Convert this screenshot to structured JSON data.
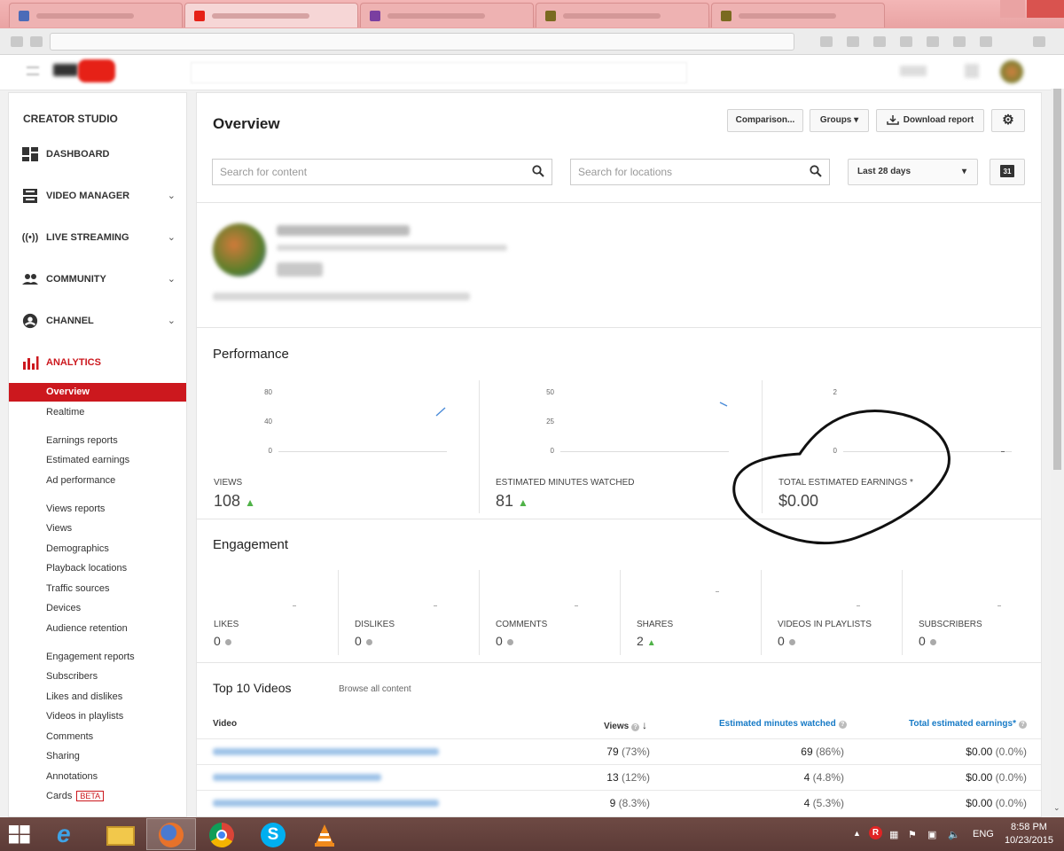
{
  "studio": {
    "title": "CREATOR STUDIO",
    "main_items": [
      {
        "label": "DASHBOARD",
        "icon": "dashboard-icon"
      },
      {
        "label": "VIDEO MANAGER",
        "icon": "video-manager-icon"
      },
      {
        "label": "LIVE STREAMING",
        "icon": "live-streaming-icon"
      },
      {
        "label": "COMMUNITY",
        "icon": "community-icon"
      },
      {
        "label": "CHANNEL",
        "icon": "channel-icon"
      },
      {
        "label": "ANALYTICS",
        "icon": "analytics-icon"
      }
    ],
    "analytics_items": [
      "Overview",
      "Realtime",
      "Earnings reports",
      "Estimated earnings",
      "Ad performance",
      "Views reports",
      "Views",
      "Demographics",
      "Playback locations",
      "Traffic sources",
      "Devices",
      "Audience retention",
      "Engagement reports",
      "Subscribers",
      "Likes and dislikes",
      "Videos in playlists",
      "Comments",
      "Sharing",
      "Annotations",
      "Cards"
    ],
    "beta_label": "BETA",
    "accent": "#cc181e"
  },
  "header": {
    "title": "Overview",
    "comparison": "Comparison...",
    "groups": "Groups",
    "download": "Download report",
    "search_content": "Search for content",
    "search_locations": "Search for locations",
    "date_range": "Last 28 days",
    "calendar_day": "31"
  },
  "performance": {
    "title": "Performance",
    "metrics": [
      {
        "label": "VIEWS",
        "value": "108",
        "ticks": [
          "80",
          "40",
          "0"
        ]
      },
      {
        "label": "ESTIMATED MINUTES WATCHED",
        "value": "81",
        "ticks": [
          "50",
          "25",
          "0"
        ]
      },
      {
        "label": "TOTAL ESTIMATED EARNINGS *",
        "value": "$0.00",
        "ticks": [
          "2",
          "0"
        ]
      }
    ]
  },
  "engagement": {
    "title": "Engagement",
    "metrics": [
      {
        "label": "LIKES",
        "value": "0"
      },
      {
        "label": "DISLIKES",
        "value": "0"
      },
      {
        "label": "COMMENTS",
        "value": "0"
      },
      {
        "label": "SHARES",
        "value": "2"
      },
      {
        "label": "VIDEOS IN PLAYLISTS",
        "value": "0"
      },
      {
        "label": "SUBSCRIBERS",
        "value": "0"
      }
    ]
  },
  "top_videos": {
    "title": "Top 10 Videos",
    "browse": "Browse all content",
    "columns": [
      "Video",
      "Views",
      "Estimated minutes watched",
      "Total estimated earnings*"
    ],
    "rows": [
      {
        "views": "79",
        "views_pct": "(73%)",
        "minutes": "69",
        "minutes_pct": "(86%)",
        "earnings": "$0.00",
        "earnings_pct": "(0.0%)"
      },
      {
        "views": "13",
        "views_pct": "(12%)",
        "minutes": "4",
        "minutes_pct": "(4.8%)",
        "earnings": "$0.00",
        "earnings_pct": "(0.0%)"
      },
      {
        "views": "9",
        "views_pct": "(8.3%)",
        "minutes": "4",
        "minutes_pct": "(5.3%)",
        "earnings": "$0.00",
        "earnings_pct": "(0.0%)"
      }
    ]
  },
  "taskbar": {
    "lang": "ENG",
    "time": "8:58 PM",
    "date": "10/23/2015"
  }
}
